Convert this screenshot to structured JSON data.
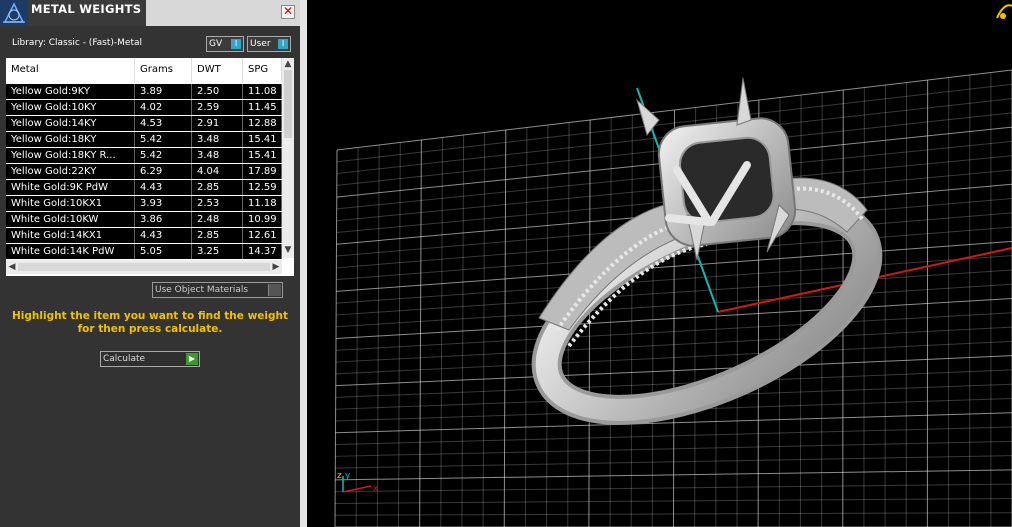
{
  "panel": {
    "title": "METAL WEIGHTS",
    "close_glyph": "✕",
    "library_label": "Library: Classic - (Fast)-Metal",
    "toggles": [
      {
        "label": "GV",
        "knob": "I"
      },
      {
        "label": "User",
        "knob": "I"
      }
    ],
    "table": {
      "columns": [
        "Metal",
        "Grams",
        "DWT",
        "SPG"
      ],
      "rows": [
        [
          "Yellow Gold:9KY",
          "3.89",
          "2.50",
          "11.08"
        ],
        [
          "Yellow Gold:10KY",
          "4.02",
          "2.59",
          "11.45"
        ],
        [
          "Yellow Gold:14KY",
          "4.53",
          "2.91",
          "12.88"
        ],
        [
          "Yellow Gold:18KY",
          "5.42",
          "3.48",
          "15.41"
        ],
        [
          "Yellow Gold:18KY R...",
          "5.42",
          "3.48",
          "15.41"
        ],
        [
          "Yellow Gold:22KY",
          "6.29",
          "4.04",
          "17.89"
        ],
        [
          "White Gold:9K PdW",
          "4.43",
          "2.85",
          "12.59"
        ],
        [
          "White Gold:10KX1",
          "3.93",
          "2.53",
          "11.18"
        ],
        [
          "White Gold:10KW",
          "3.86",
          "2.48",
          "10.99"
        ],
        [
          "White Gold:14KX1",
          "4.43",
          "2.85",
          "12.61"
        ],
        [
          "White Gold:14K PdW",
          "5.05",
          "3.25",
          "14.37"
        ]
      ]
    },
    "use_object_materials": "Use Object Materials",
    "instruction": "Highlight the item you want to find the weight for then press calculate.",
    "calculate_label": "Calculate",
    "icons": {
      "logo": "app-logo-icon",
      "calc": "play-arrow-icon"
    }
  },
  "viewport": {
    "axis_labels": {
      "z": "z",
      "y": "y",
      "x": "x"
    },
    "colors": {
      "grid": "#ffffff",
      "axis_x": "#d01818",
      "axis_y": "#12b8b8",
      "ring": "#c9c9c9",
      "instruction": "#f2c200"
    }
  }
}
